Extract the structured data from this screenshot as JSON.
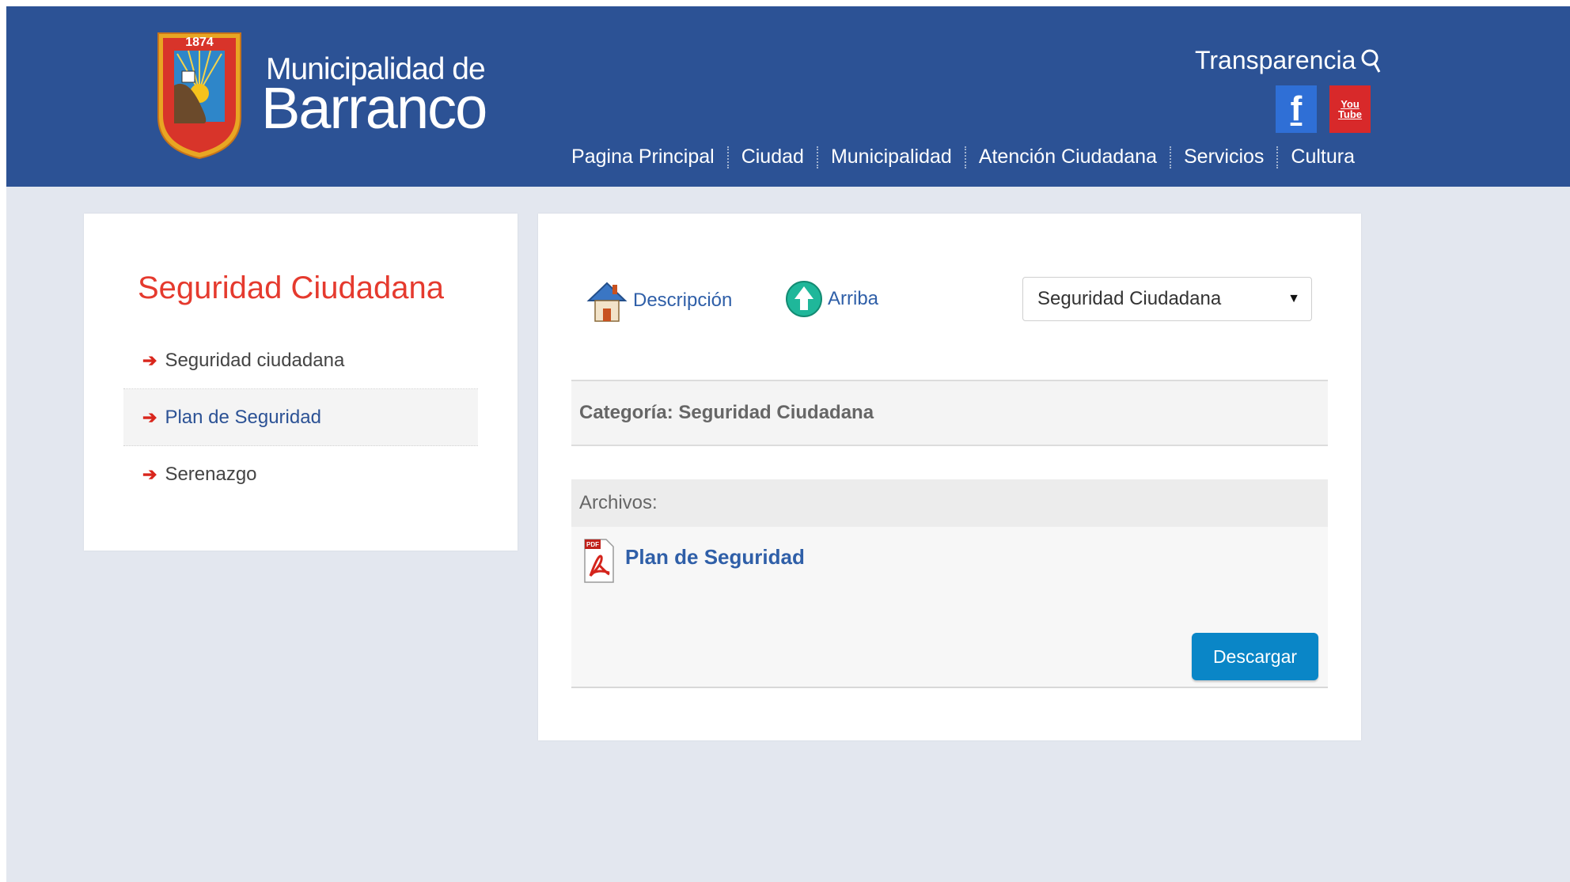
{
  "header": {
    "logo": {
      "year": "1874",
      "ring_text": "MUNICIPALIDAD DE BARRANCO",
      "line1": "Municipalidad de",
      "line2": "Barranco"
    },
    "transparencia_label": "Transparencia",
    "social": {
      "facebook_glyph": "f",
      "youtube_top": "You",
      "youtube_bottom": "Tube"
    },
    "nav": [
      "Pagina Principal",
      "Ciudad",
      "Municipalidad",
      "Atención Ciudadana",
      "Servicios",
      "Cultura"
    ]
  },
  "sidebar": {
    "title": "Seguridad Ciudadana",
    "items": [
      {
        "label": "Seguridad ciudadana",
        "active": false
      },
      {
        "label": "Plan de Seguridad",
        "active": true
      },
      {
        "label": "Serenazgo",
        "active": false
      }
    ]
  },
  "main": {
    "toolbar": {
      "descripcion": "Descripción",
      "arriba": "Arriba"
    },
    "select": {
      "value": "Seguridad Ciudadana"
    },
    "category": "Categoría: Seguridad Ciudadana",
    "files": {
      "heading": "Archivos:",
      "items": [
        {
          "name": "Plan de Seguridad",
          "icon_label": "PDF"
        }
      ],
      "download_label": "Descargar"
    }
  },
  "colors": {
    "header": "#2c5295",
    "accent_red": "#e53a2e",
    "link_blue": "#2f5fa8",
    "button": "#0a86c7"
  }
}
